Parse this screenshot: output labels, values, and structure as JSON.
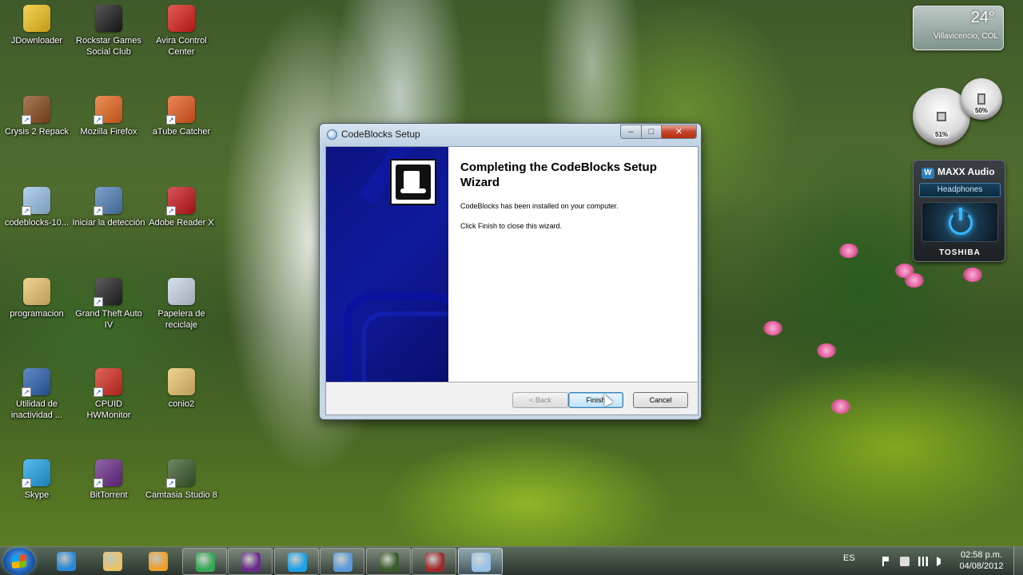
{
  "desktop_icons": [
    {
      "label": "JDownloader",
      "icon": "jdownloader-icon",
      "color": "#f2c21b"
    },
    {
      "label": "Rockstar Games Social Club",
      "icon": "rockstar-icon",
      "color": "#1a1a1a"
    },
    {
      "label": "Avira Control Center",
      "icon": "avira-icon",
      "color": "#d91e18"
    },
    {
      "label": "Crysis 2 Repack",
      "icon": "crysis-icon",
      "color": "#8a4b1c"
    },
    {
      "label": "Mozilla Firefox",
      "icon": "firefox-icon",
      "color": "#e8661d"
    },
    {
      "label": "aTube Catcher",
      "icon": "atube-icon",
      "color": "#e65a1c"
    },
    {
      "label": "codeblocks-10...",
      "icon": "installer-icon",
      "color": "#9ac2e8"
    },
    {
      "label": "Iniciar la detección",
      "icon": "shield-icon",
      "color": "#4f7fb8"
    },
    {
      "label": "Adobe Reader X",
      "icon": "adobe-reader-icon",
      "color": "#c8161d"
    },
    {
      "label": "programacion",
      "icon": "folder-icon",
      "color": "#e9c46a"
    },
    {
      "label": "Grand Theft Auto IV",
      "icon": "gta-icon",
      "color": "#222222"
    },
    {
      "label": "Papelera de reciclaje",
      "icon": "recycle-bin-icon",
      "color": "#c9d6e3"
    },
    {
      "label": "Utilidad de inactividad ...",
      "icon": "sleep-utility-icon",
      "color": "#2a5fb0"
    },
    {
      "label": "CPUID HWMonitor",
      "icon": "hwmonitor-icon",
      "color": "#d62b1f"
    },
    {
      "label": "conio2",
      "icon": "folder-icon",
      "color": "#e9c46a"
    },
    {
      "label": "Skype",
      "icon": "skype-icon",
      "color": "#1ea1e6"
    },
    {
      "label": "BitTorrent",
      "icon": "bittorrent-icon",
      "color": "#6a2a8a"
    },
    {
      "label": "Camtasia Studio 8",
      "icon": "camtasia-icon",
      "color": "#3a5a2a"
    }
  ],
  "gadgets": {
    "weather": {
      "temperature": "24°",
      "location": "Villavicencio, COL"
    },
    "cpu_meter": {
      "left_value": "51%",
      "right_value": "50%"
    },
    "maxx_audio": {
      "brand": "MAXX Audio",
      "mode": "Headphones",
      "vendor": "TOSHIBA"
    }
  },
  "window": {
    "title": "CodeBlocks Setup",
    "caption_buttons": {
      "minimize": "–",
      "maximize": "□",
      "close": "✕"
    },
    "heading": "Completing the CodeBlocks Setup Wizard",
    "message_installed": "CodeBlocks has been installed on your computer.",
    "message_finish": "Click Finish to close this wizard.",
    "buttons": {
      "back": "< Back",
      "finish": "Finish",
      "cancel": "Cancel"
    }
  },
  "taskbar": {
    "apps": [
      {
        "name": "internet-explorer",
        "color": "#2b88d8",
        "state": "pinned"
      },
      {
        "name": "windows-explorer",
        "color": "#e8c46a",
        "state": "pinned"
      },
      {
        "name": "media-player",
        "color": "#f0a02a",
        "state": "pinned"
      },
      {
        "name": "chrome",
        "color": "#34a853",
        "state": "running"
      },
      {
        "name": "bittorrent",
        "color": "#6a2a8a",
        "state": "running"
      },
      {
        "name": "skype",
        "color": "#1ea1e6",
        "state": "running"
      },
      {
        "name": "messenger",
        "color": "#5a9ad8",
        "state": "running"
      },
      {
        "name": "camtasia",
        "color": "#3a5a2a",
        "state": "running"
      },
      {
        "name": "camtasia-recorder",
        "color": "#a02a2a",
        "state": "running"
      },
      {
        "name": "codeblocks-setup",
        "color": "#9ac2e8",
        "state": "active"
      }
    ],
    "tray": {
      "language": "ES",
      "time": "02:58 p.m.",
      "date": "04/08/2012"
    }
  },
  "colors": {
    "installer_banner": "#0f1a9c",
    "close_button": "#c5442a",
    "accent_blue": "#3c7fb1"
  }
}
